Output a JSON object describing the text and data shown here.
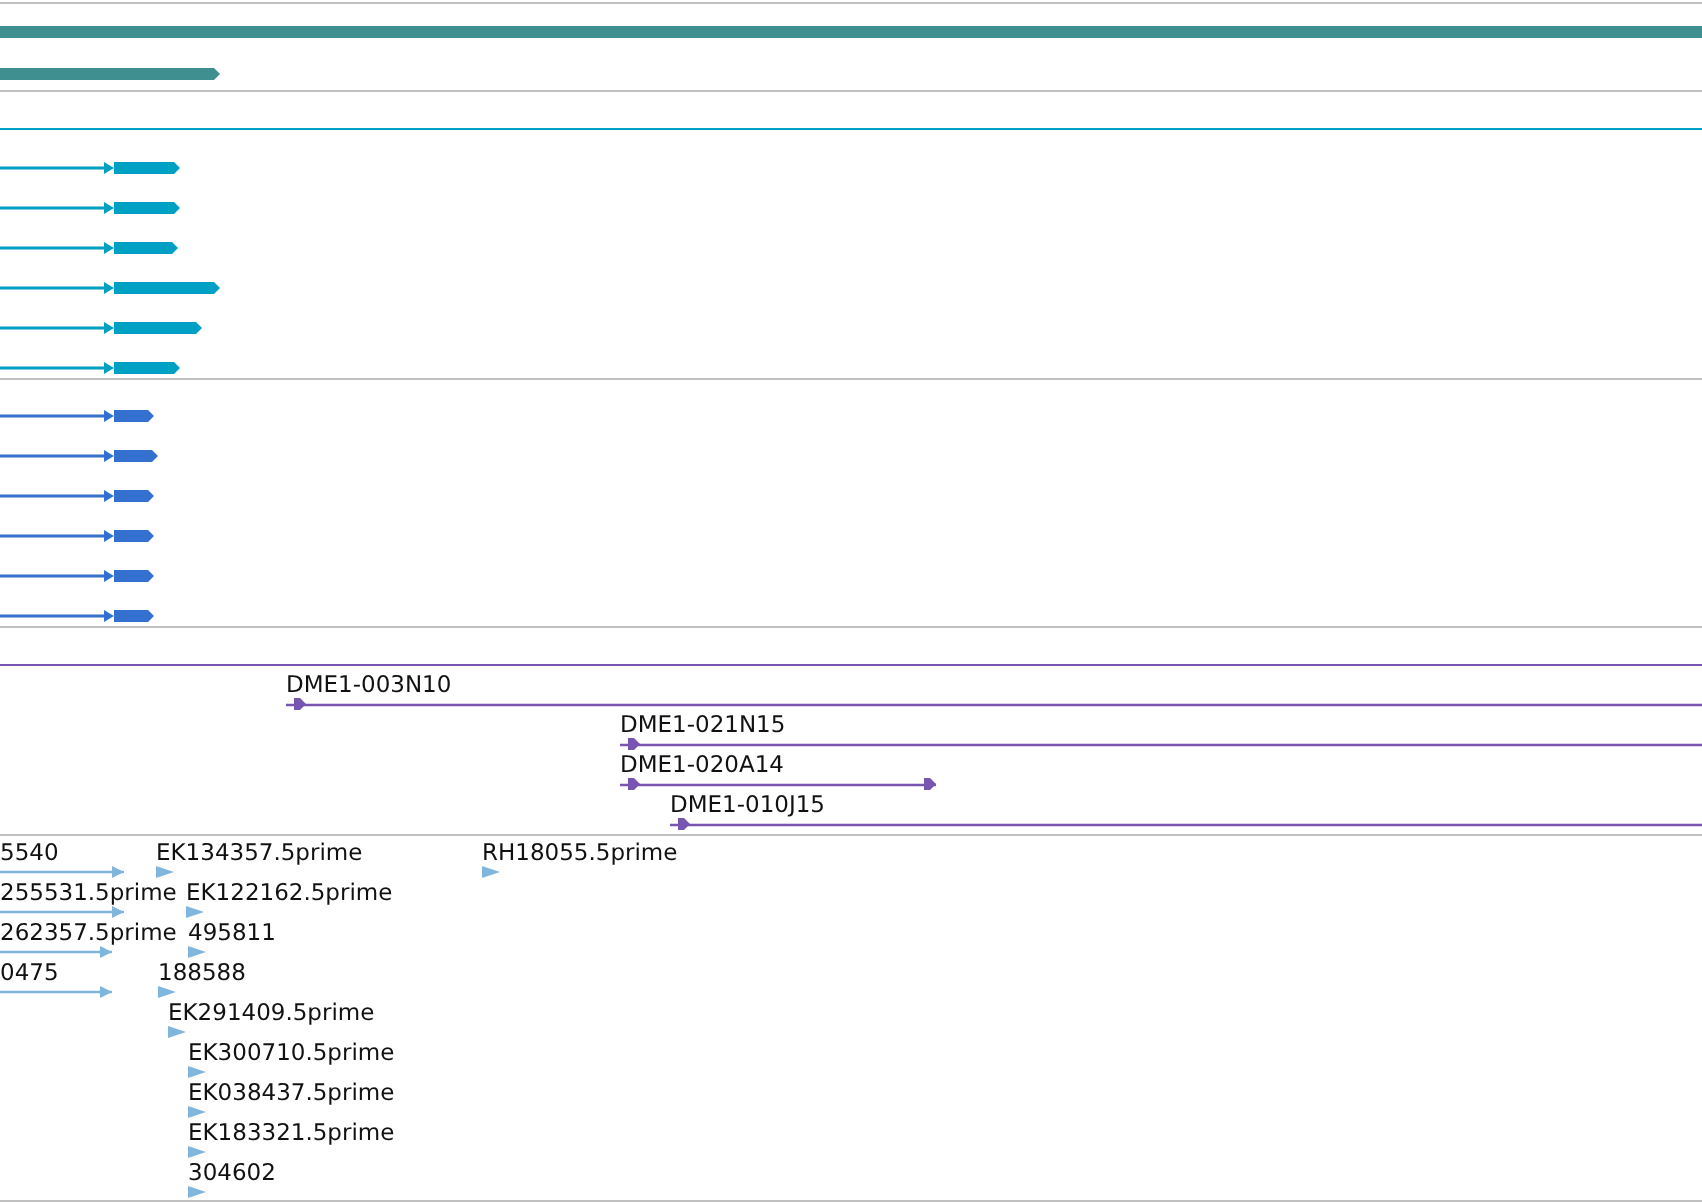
{
  "tracks": [
    {
      "color": "#3f8f91",
      "features": [
        {
          "kind": "bar"
        },
        {
          "kind": "bar"
        }
      ]
    },
    {
      "color": "#00a0c4",
      "features": [
        {
          "kind": "span"
        },
        {
          "kind": "transcript"
        },
        {
          "kind": "transcript"
        },
        {
          "kind": "transcript"
        },
        {
          "kind": "transcript"
        },
        {
          "kind": "transcript"
        },
        {
          "kind": "transcript"
        }
      ]
    },
    {
      "color": "#3370cf",
      "features": [
        {
          "kind": "transcript"
        },
        {
          "kind": "transcript"
        },
        {
          "kind": "transcript"
        },
        {
          "kind": "transcript"
        },
        {
          "kind": "transcript"
        },
        {
          "kind": "transcript"
        }
      ]
    },
    {
      "color": "#7755b0",
      "features": [
        {
          "kind": "span"
        },
        {
          "kind": "clone",
          "label": "DME1-003N10"
        },
        {
          "kind": "clone",
          "label": "DME1-021N15"
        },
        {
          "kind": "clone",
          "label": "DME1-020A14"
        },
        {
          "kind": "clone",
          "label": "DME1-010J15"
        }
      ]
    },
    {
      "color": "#80b6dd",
      "features": [
        {
          "kind": "read",
          "label": "5540"
        },
        {
          "kind": "read",
          "label": "EK134357.5prime"
        },
        {
          "kind": "read",
          "label": "RH18055.5prime"
        },
        {
          "kind": "read",
          "label": "255531.5prime"
        },
        {
          "kind": "read",
          "label": "EK122162.5prime"
        },
        {
          "kind": "read",
          "label": "262357.5prime"
        },
        {
          "kind": "read",
          "label": "495811"
        },
        {
          "kind": "read",
          "label": "0475"
        },
        {
          "kind": "read",
          "label": "188588"
        },
        {
          "kind": "read",
          "label": "EK291409.5prime"
        },
        {
          "kind": "read",
          "label": "EK300710.5prime"
        },
        {
          "kind": "read",
          "label": "EK038437.5prime"
        },
        {
          "kind": "read",
          "label": "EK183321.5prime"
        },
        {
          "kind": "read",
          "label": "304602"
        }
      ]
    }
  ]
}
